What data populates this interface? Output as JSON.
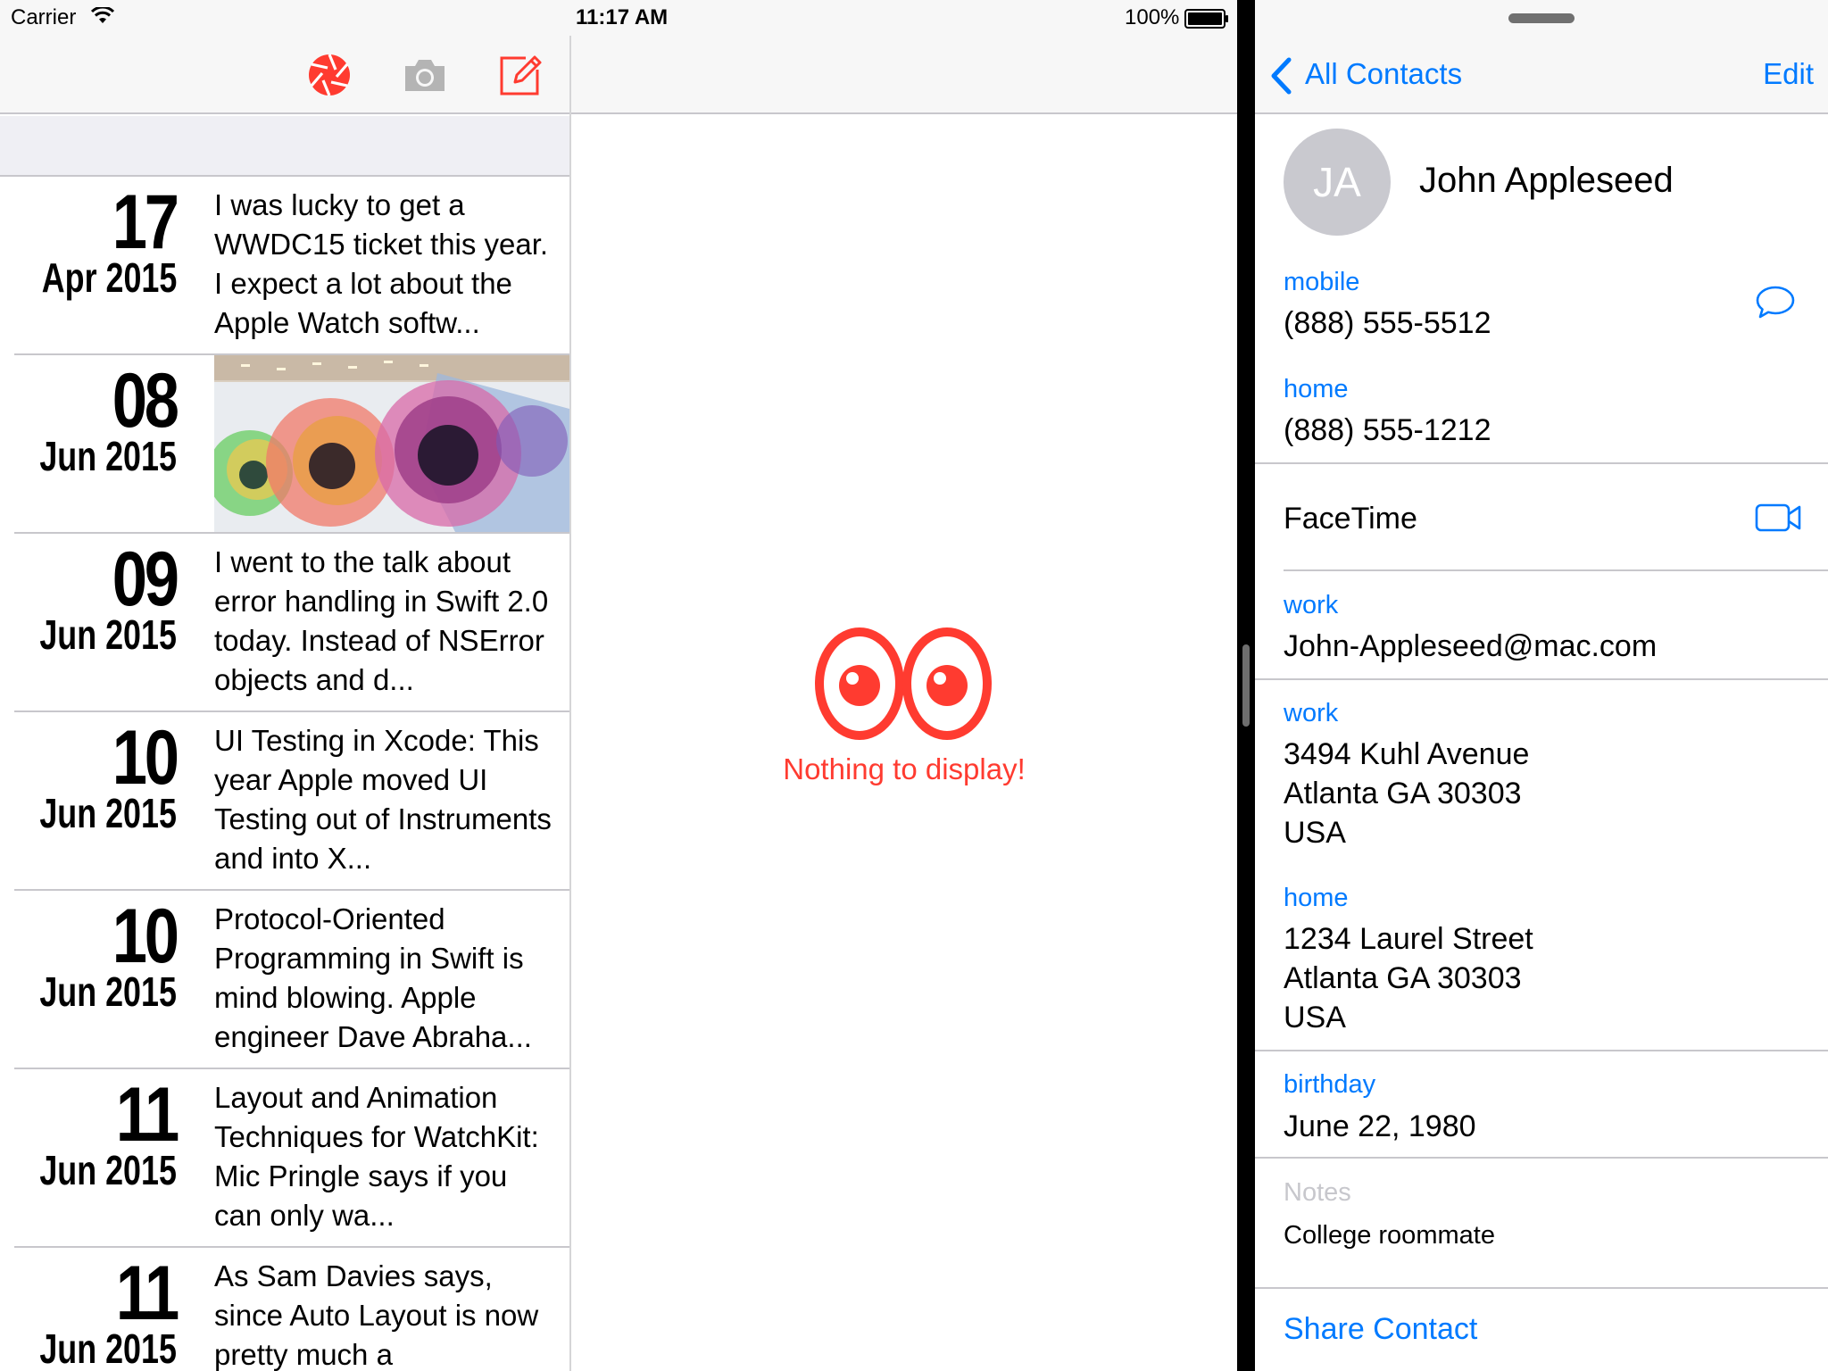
{
  "status_bar": {
    "carrier": "Carrier",
    "time": "11:17 AM",
    "battery": "100%"
  },
  "journal": {
    "toolbar_icons": [
      "shutter-icon",
      "camera-icon",
      "compose-icon"
    ],
    "entries": [
      {
        "day": "17",
        "month_year": "Apr 2015",
        "text": "I was lucky to get a WWDC15 ticket this year. I expect a lot about the Apple Watch softw..."
      },
      {
        "day": "08",
        "month_year": "Jun 2015",
        "photo": "wwdc-banner-photo"
      },
      {
        "day": "09",
        "month_year": "Jun 2015",
        "text": "I went to the talk about error handling in Swift 2.0 today. Instead of NSError objects and d..."
      },
      {
        "day": "10",
        "month_year": "Jun 2015",
        "text": "UI Testing in Xcode: This year Apple moved UI Testing out of Instruments and into X..."
      },
      {
        "day": "10",
        "month_year": "Jun 2015",
        "text": "Protocol-Oriented Programming in Swift is mind blowing. Apple engineer Dave Abraha..."
      },
      {
        "day": "11",
        "month_year": "Jun 2015",
        "text": "Layout and Animation Techniques for WatchKit: Mic Pringle says if you can only wa..."
      },
      {
        "day": "11",
        "month_year": "Jun 2015",
        "text": "As Sam Davies says, since Auto Layout is now pretty much a"
      }
    ]
  },
  "detail": {
    "empty_message": "Nothing to display!",
    "accent_color": "#ff3b30"
  },
  "contact": {
    "back_label": "All Contacts",
    "edit_label": "Edit",
    "initials": "JA",
    "name": "John Appleseed",
    "mobile_label": "mobile",
    "mobile_value": "(888) 555-5512",
    "home_phone_label": "home",
    "home_phone_value": "(888) 555-1212",
    "facetime_label": "FaceTime",
    "email_label": "work",
    "email_value": "John-Appleseed@mac.com",
    "work_address_label": "work",
    "work_address": [
      "3494 Kuhl Avenue",
      "Atlanta GA 30303",
      "USA"
    ],
    "home_address_label": "home",
    "home_address": [
      "1234 Laurel Street",
      "Atlanta GA 30303",
      "USA"
    ],
    "birthday_label": "birthday",
    "birthday_value": "June 22, 1980",
    "notes_label": "Notes",
    "notes_value": "College roommate",
    "share_label": "Share Contact",
    "tint_color": "#007aff"
  }
}
